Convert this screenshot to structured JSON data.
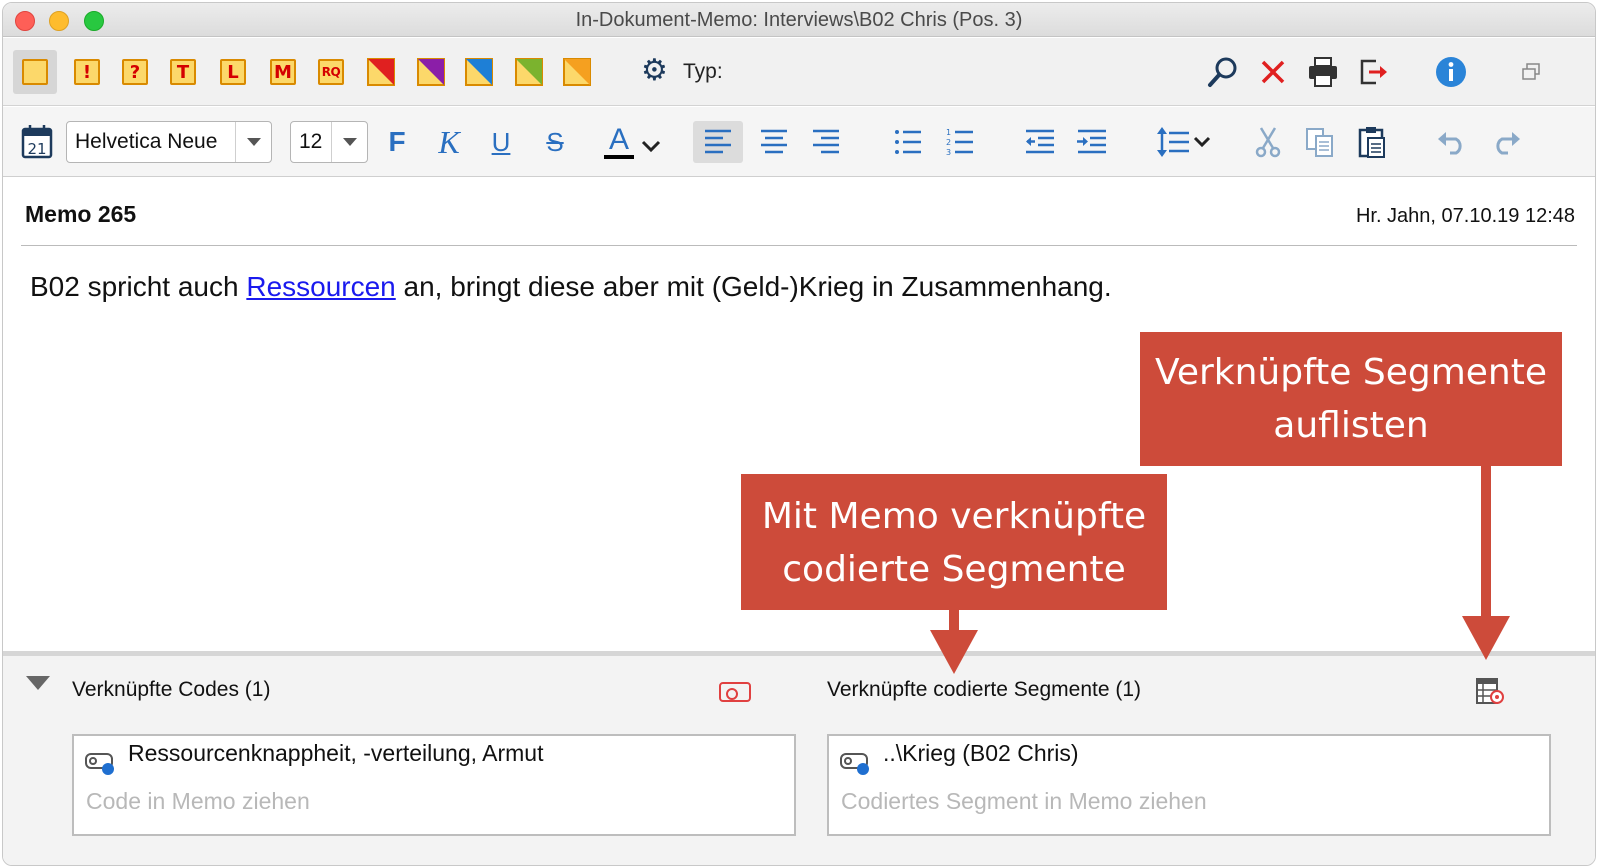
{
  "window": {
    "title": "In-Dokument-Memo: Interviews\\B02 Chris (Pos. 3)"
  },
  "toolbar1": {
    "memo_types": [
      {
        "icon": "memo-plain-icon",
        "letter": ""
      },
      {
        "icon": "memo-exclamation-icon",
        "letter": "!"
      },
      {
        "icon": "memo-question-icon",
        "letter": "?"
      },
      {
        "icon": "memo-t-icon",
        "letter": "T"
      },
      {
        "icon": "memo-l-icon",
        "letter": "L"
      },
      {
        "icon": "memo-m-icon",
        "letter": "M"
      },
      {
        "icon": "memo-rq-icon",
        "letter": "RQ"
      },
      {
        "icon": "memo-red-icon",
        "color": "#e02020"
      },
      {
        "icon": "memo-purple-icon",
        "color": "#8b1ea8"
      },
      {
        "icon": "memo-blue-icon",
        "color": "#1e7fd6"
      },
      {
        "icon": "memo-green-icon",
        "color": "#7bb32e"
      },
      {
        "icon": "memo-orange-icon",
        "color": "#f5a020"
      }
    ],
    "type_label": "Typ:"
  },
  "toolbar2": {
    "font_name": "Helvetica Neue",
    "font_size": "12",
    "bold_label": "F",
    "italic_label": "K",
    "underline_label": "U",
    "strike_label": "S",
    "color_label": "A",
    "calendar_day": "21"
  },
  "memo": {
    "title": "Memo 265",
    "meta": "Hr. Jahn, 07.10.19 12:48",
    "body_before": "B02 spricht auch ",
    "body_link": "Ressourcen",
    "body_after": " an, bringt diese aber mit (Geld-)Krieg in Zusammenhang."
  },
  "linked_codes": {
    "label": "Verknüpfte Codes (1)",
    "item": "Ressourcenknappheit, -verteilung, Armut",
    "placeholder": "Code in Memo ziehen"
  },
  "linked_segments": {
    "label": "Verknüpfte codierte Segmente (1)",
    "item": "..\\Krieg (B02 Chris)",
    "placeholder": "Codiertes Segment in Memo ziehen"
  },
  "callouts": {
    "list_segments_line1": "Verknüpfte Segmente",
    "list_segments_line2": "auflisten",
    "memo_segments_line1": "Mit Memo verknüpfte",
    "memo_segments_line2": "codierte Segmente",
    "color": "#cd4b3a"
  }
}
